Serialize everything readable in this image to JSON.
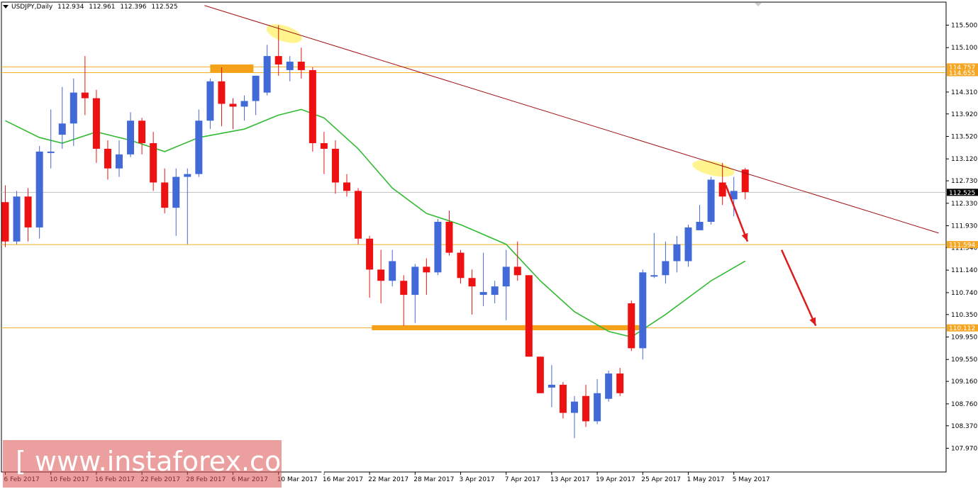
{
  "header": {
    "symbol": "USDJPY,Daily",
    "open": "112.934",
    "high": "112.961",
    "low": "112.396",
    "close": "112.525"
  },
  "watermark": {
    "text": "[ www.instaforex.com ]"
  },
  "colors": {
    "bull": "#4169d8",
    "bear": "#ee1111",
    "ma": "#33bb33",
    "trendline": "#a01010",
    "level": "#f0b020",
    "zone": "#f5a21a",
    "highlight": "#fff27a",
    "arrow": "#dd1c1c",
    "price_line": "#c0c0c0",
    "axis_label_bg": "#f5a623",
    "current_label_bg": "#000000"
  },
  "chart_data": {
    "type": "candlestick",
    "symbol": "USDJPY",
    "timeframe": "Daily",
    "ylim": [
      107.8,
      115.8
    ],
    "y_ticks": [
      "115.500",
      "115.100",
      "114.310",
      "113.920",
      "113.520",
      "113.120",
      "112.730",
      "112.330",
      "111.930",
      "111.540",
      "111.140",
      "110.740",
      "110.350",
      "109.950",
      "109.550",
      "109.160",
      "108.760",
      "108.370",
      "107.970"
    ],
    "x_ticks": [
      "6 Feb 2017",
      "10 Feb 2017",
      "16 Feb 2017",
      "22 Feb 2017",
      "28 Feb 2017",
      "6 Mar 2017",
      "10 Mar 2017",
      "16 Mar 2017",
      "22 Mar 2017",
      "28 Mar 2017",
      "3 Apr 2017",
      "7 Apr 2017",
      "13 Apr 2017",
      "19 Apr 2017",
      "25 Apr 2017",
      "1 May 2017",
      "5 May 2017"
    ],
    "candles": [
      {
        "o": 112.35,
        "h": 112.65,
        "l": 111.55,
        "c": 111.65
      },
      {
        "o": 111.65,
        "h": 112.55,
        "l": 111.6,
        "c": 112.45
      },
      {
        "o": 112.45,
        "h": 112.6,
        "l": 111.65,
        "c": 111.9
      },
      {
        "o": 111.9,
        "h": 113.35,
        "l": 111.7,
        "c": 113.25
      },
      {
        "o": 113.25,
        "h": 114.0,
        "l": 112.95,
        "c": 113.25
      },
      {
        "o": 113.55,
        "h": 114.4,
        "l": 113.3,
        "c": 113.75
      },
      {
        "o": 113.75,
        "h": 114.55,
        "l": 113.35,
        "c": 114.3
      },
      {
        "o": 114.3,
        "h": 114.95,
        "l": 113.9,
        "c": 114.2
      },
      {
        "o": 114.2,
        "h": 114.35,
        "l": 113.05,
        "c": 113.3
      },
      {
        "o": 113.3,
        "h": 113.45,
        "l": 112.75,
        "c": 112.95
      },
      {
        "o": 112.95,
        "h": 113.45,
        "l": 112.8,
        "c": 113.2
      },
      {
        "o": 113.2,
        "h": 113.95,
        "l": 113.15,
        "c": 113.8
      },
      {
        "o": 113.8,
        "h": 113.85,
        "l": 113.2,
        "c": 113.4
      },
      {
        "o": 113.4,
        "h": 113.6,
        "l": 112.55,
        "c": 112.7
      },
      {
        "o": 112.7,
        "h": 112.95,
        "l": 112.15,
        "c": 112.25
      },
      {
        "o": 112.25,
        "h": 112.95,
        "l": 111.75,
        "c": 112.8
      },
      {
        "o": 112.8,
        "h": 112.95,
        "l": 111.6,
        "c": 112.85
      },
      {
        "o": 112.85,
        "h": 114.0,
        "l": 112.8,
        "c": 113.8
      },
      {
        "o": 113.8,
        "h": 114.55,
        "l": 113.65,
        "c": 114.5
      },
      {
        "o": 114.5,
        "h": 114.75,
        "l": 113.7,
        "c": 114.1
      },
      {
        "o": 114.1,
        "h": 114.2,
        "l": 113.65,
        "c": 114.05
      },
      {
        "o": 114.05,
        "h": 114.25,
        "l": 113.8,
        "c": 114.15
      },
      {
        "o": 114.15,
        "h": 114.6,
        "l": 113.9,
        "c": 114.6
      },
      {
        "o": 114.3,
        "h": 115.15,
        "l": 114.25,
        "c": 114.95
      },
      {
        "o": 114.95,
        "h": 115.5,
        "l": 114.6,
        "c": 114.8
      },
      {
        "o": 114.7,
        "h": 114.95,
        "l": 114.5,
        "c": 114.85
      },
      {
        "o": 114.85,
        "h": 115.1,
        "l": 114.55,
        "c": 114.7
      },
      {
        "o": 114.7,
        "h": 114.75,
        "l": 113.25,
        "c": 113.4
      },
      {
        "o": 113.4,
        "h": 113.6,
        "l": 112.85,
        "c": 113.3
      },
      {
        "o": 113.3,
        "h": 113.45,
        "l": 112.5,
        "c": 112.7
      },
      {
        "o": 112.7,
        "h": 112.85,
        "l": 112.45,
        "c": 112.55
      },
      {
        "o": 112.55,
        "h": 112.6,
        "l": 111.6,
        "c": 111.7
      },
      {
        "o": 111.7,
        "h": 111.75,
        "l": 110.65,
        "c": 111.15
      },
      {
        "o": 111.15,
        "h": 111.5,
        "l": 110.55,
        "c": 110.95
      },
      {
        "o": 110.95,
        "h": 111.5,
        "l": 110.85,
        "c": 111.3
      },
      {
        "o": 110.95,
        "h": 111.05,
        "l": 110.15,
        "c": 110.7
      },
      {
        "o": 110.7,
        "h": 111.25,
        "l": 110.2,
        "c": 111.2
      },
      {
        "o": 111.2,
        "h": 111.35,
        "l": 110.7,
        "c": 111.1
      },
      {
        "o": 111.1,
        "h": 112.05,
        "l": 111.05,
        "c": 112.0
      },
      {
        "o": 112.0,
        "h": 112.2,
        "l": 111.4,
        "c": 111.45
      },
      {
        "o": 111.45,
        "h": 111.5,
        "l": 110.9,
        "c": 111.0
      },
      {
        "o": 111.0,
        "h": 111.15,
        "l": 110.35,
        "c": 110.85
      },
      {
        "o": 110.7,
        "h": 111.45,
        "l": 110.5,
        "c": 110.75
      },
      {
        "o": 110.7,
        "h": 110.95,
        "l": 110.55,
        "c": 110.85
      },
      {
        "o": 110.85,
        "h": 111.5,
        "l": 110.25,
        "c": 111.2
      },
      {
        "o": 111.2,
        "h": 111.65,
        "l": 110.95,
        "c": 111.05
      },
      {
        "o": 111.05,
        "h": 111.05,
        "l": 109.6,
        "c": 109.6
      },
      {
        "o": 109.6,
        "h": 109.6,
        "l": 108.95,
        "c": 108.95
      },
      {
        "o": 109.05,
        "h": 109.45,
        "l": 108.7,
        "c": 109.1
      },
      {
        "o": 109.1,
        "h": 109.15,
        "l": 108.5,
        "c": 108.6
      },
      {
        "o": 108.6,
        "h": 108.9,
        "l": 108.15,
        "c": 108.8
      },
      {
        "o": 108.9,
        "h": 109.1,
        "l": 108.35,
        "c": 108.45
      },
      {
        "o": 108.45,
        "h": 109.2,
        "l": 108.4,
        "c": 108.95
      },
      {
        "o": 108.85,
        "h": 109.35,
        "l": 108.8,
        "c": 109.3
      },
      {
        "o": 109.3,
        "h": 109.4,
        "l": 108.9,
        "c": 108.95
      },
      {
        "o": 110.55,
        "h": 110.6,
        "l": 109.7,
        "c": 109.75
      },
      {
        "o": 109.75,
        "h": 111.15,
        "l": 109.55,
        "c": 111.1
      },
      {
        "o": 111.05,
        "h": 111.8,
        "l": 111.0,
        "c": 111.05
      },
      {
        "o": 111.05,
        "h": 111.65,
        "l": 110.9,
        "c": 111.3
      },
      {
        "o": 111.3,
        "h": 111.75,
        "l": 111.1,
        "c": 111.6
      },
      {
        "o": 111.3,
        "h": 111.95,
        "l": 111.2,
        "c": 111.9
      },
      {
        "o": 111.85,
        "h": 112.3,
        "l": 111.85,
        "c": 112.0
      },
      {
        "o": 112.0,
        "h": 112.8,
        "l": 111.95,
        "c": 112.75
      },
      {
        "o": 112.7,
        "h": 113.05,
        "l": 112.3,
        "c": 112.45
      },
      {
        "o": 112.4,
        "h": 112.8,
        "l": 112.1,
        "c": 112.55
      },
      {
        "o": 112.93,
        "h": 112.96,
        "l": 112.4,
        "c": 112.53
      }
    ],
    "moving_average": [
      {
        "i": 0,
        "v": 113.8
      },
      {
        "i": 3,
        "v": 113.5
      },
      {
        "i": 5,
        "v": 113.4
      },
      {
        "i": 8,
        "v": 113.6
      },
      {
        "i": 11,
        "v": 113.45
      },
      {
        "i": 14,
        "v": 113.25
      },
      {
        "i": 17,
        "v": 113.5
      },
      {
        "i": 21,
        "v": 113.65
      },
      {
        "i": 24,
        "v": 113.9
      },
      {
        "i": 26,
        "v": 114.0
      },
      {
        "i": 28,
        "v": 113.85
      },
      {
        "i": 31,
        "v": 113.3
      },
      {
        "i": 34,
        "v": 112.6
      },
      {
        "i": 37,
        "v": 112.15
      },
      {
        "i": 40,
        "v": 111.95
      },
      {
        "i": 44,
        "v": 111.6
      },
      {
        "i": 47,
        "v": 110.95
      },
      {
        "i": 50,
        "v": 110.4
      },
      {
        "i": 53,
        "v": 110.05
      },
      {
        "i": 55,
        "v": 109.95
      },
      {
        "i": 58,
        "v": 110.35
      },
      {
        "i": 62,
        "v": 110.95
      },
      {
        "i": 65,
        "v": 111.3
      }
    ],
    "horizontal_levels": [
      {
        "price": 114.757,
        "label": "114.757"
      },
      {
        "price": 114.655,
        "label": "114.655"
      },
      {
        "price": 111.594,
        "label": "111.594"
      },
      {
        "price": 110.112,
        "label": "110.112"
      }
    ],
    "current_price": {
      "price": 112.525,
      "label": "112.525"
    },
    "trendline": {
      "from": {
        "i": 17.5,
        "price": 115.85
      },
      "to": {
        "i": 82,
        "price": 111.8
      }
    },
    "zones": [
      {
        "i0": 18,
        "i1": 21.8,
        "price_top": 114.8,
        "price_bot": 114.66
      },
      {
        "i0": 32.2,
        "i1": 55.8,
        "price_top": 110.16,
        "price_bot": 110.07
      }
    ],
    "highlights": [
      {
        "i": 24.5,
        "price": 115.35,
        "rx": 26,
        "ry": 11,
        "rot": 18
      },
      {
        "i": 62.2,
        "price": 112.95,
        "rx": 30,
        "ry": 10,
        "rot": 12
      }
    ],
    "arrows": [
      {
        "from": {
          "i": 63.3,
          "price": 112.65
        },
        "to": {
          "i": 65.2,
          "price": 111.65
        }
      },
      {
        "from": {
          "i": 68.2,
          "price": 111.5
        },
        "to": {
          "i": 71.2,
          "price": 110.15
        }
      }
    ]
  }
}
